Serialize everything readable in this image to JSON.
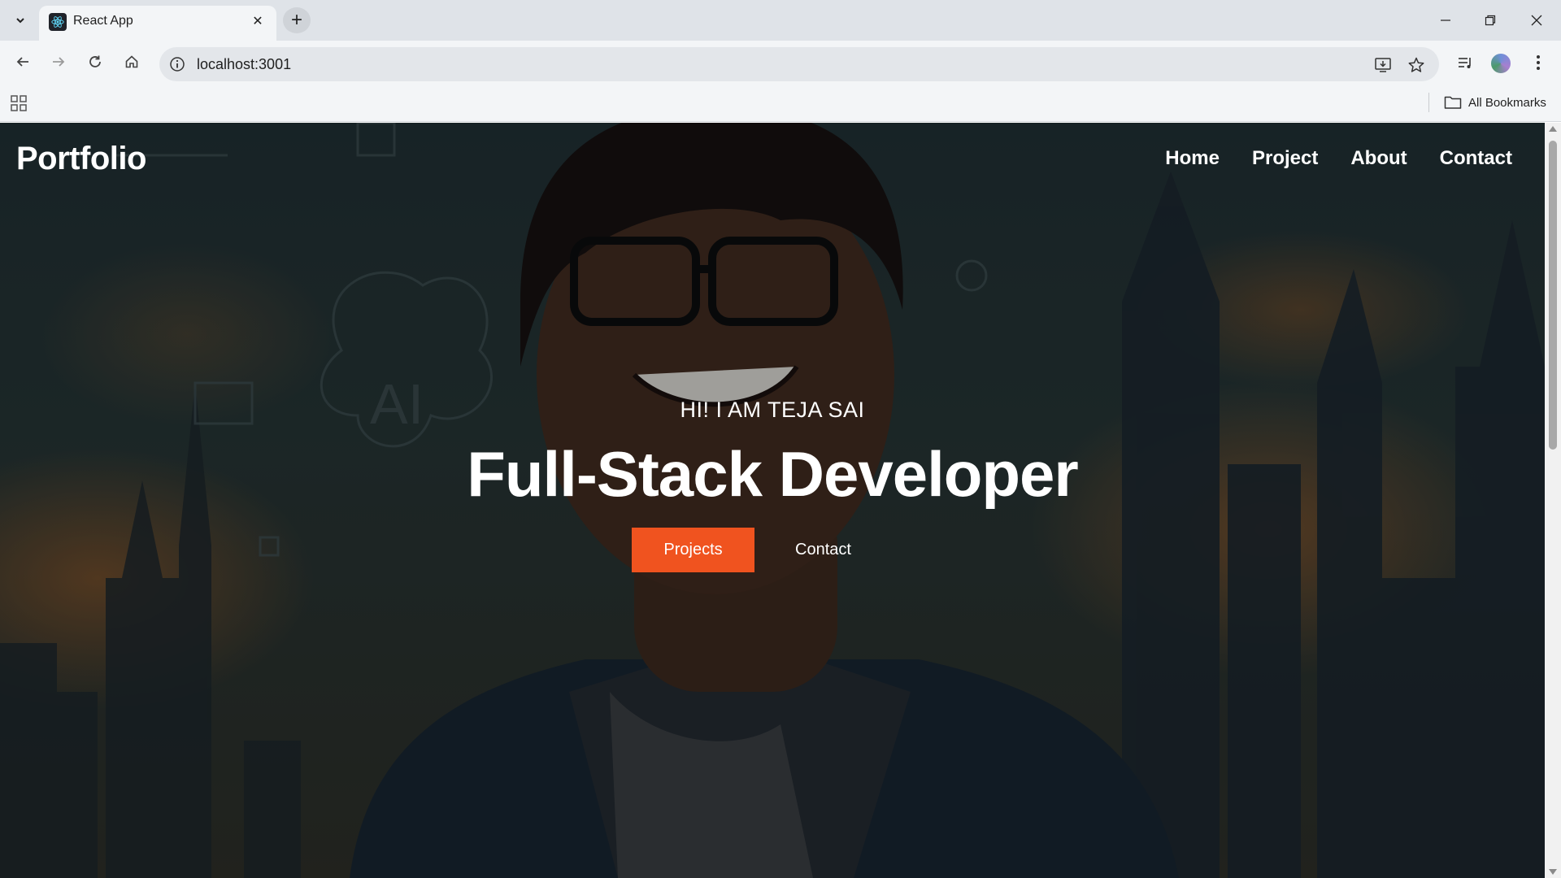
{
  "browser": {
    "tab_title": "React App",
    "url": "localhost:3001",
    "bookmarks_label": "All Bookmarks",
    "icons": {
      "tab_list": "chevron-down-icon",
      "favicon": "react-icon",
      "close_tab": "close-icon",
      "new_tab": "plus-icon",
      "back": "back-arrow-icon",
      "forward": "forward-arrow-icon",
      "reload": "reload-icon",
      "home": "home-icon",
      "site_info": "info-icon",
      "install": "install-app-icon",
      "bookmark": "star-icon",
      "media": "media-control-icon",
      "menu": "kebab-menu-icon",
      "apps": "apps-grid-icon",
      "folder": "folder-icon"
    }
  },
  "page": {
    "brand": "Portfolio",
    "nav": [
      "Home",
      "Project",
      "About",
      "Contact"
    ],
    "hero": {
      "greeting": "HI! I AM TEJA SAI",
      "title": "Full-Stack Developer",
      "primary_button": "Projects",
      "secondary_button": "Contact"
    }
  },
  "colors": {
    "accent": "#f0531f",
    "text": "#ffffff",
    "background_dark": "#1d2b2e"
  }
}
